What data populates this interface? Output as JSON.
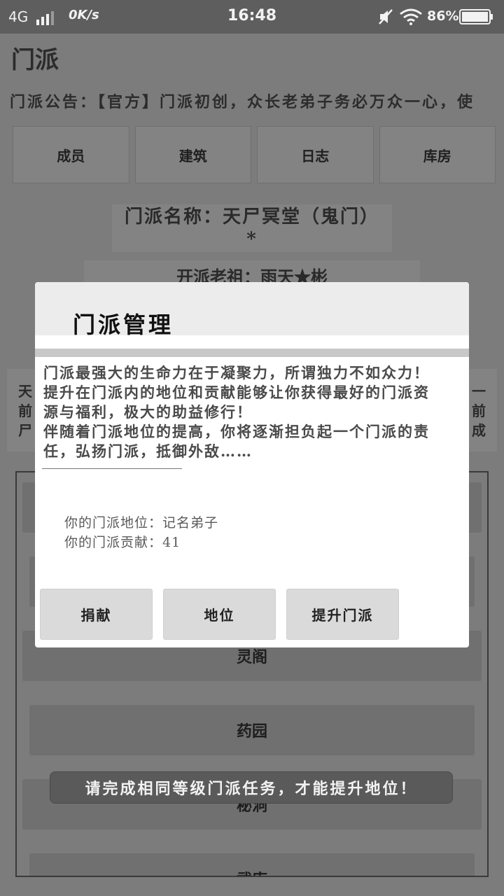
{
  "status_bar": {
    "network": "4G",
    "speed": "0K/s",
    "time": "16:48",
    "battery_percent": "86%",
    "icons": [
      "signal-icon",
      "mute-icon",
      "wifi-icon",
      "battery-icon"
    ]
  },
  "page": {
    "title": "门派",
    "notice": "门派公告：【官方】门派初创，众长老弟子务必万众一心，使",
    "tabs": [
      "成员",
      "建筑",
      "日志",
      "库房"
    ],
    "name_line1": "门派名称：天尸冥堂（鬼门）",
    "name_line2": "*",
    "founder": "开派老祖：雨天★彬",
    "info_left": [
      "天",
      "前",
      "尸"
    ],
    "info_right": [
      "一",
      "前",
      "成"
    ],
    "buildings": [
      "灵阁",
      "药园",
      "秘洞",
      "武库"
    ]
  },
  "dialog": {
    "title": "门派管理",
    "body_lines": [
      "门派最强大的生命力在于凝聚力，所谓独力不如众力！",
      "提升在门派内的地位和贡献能够让你获得最好的门派资",
      "源与福利，极大的助益修行！",
      "伴随着门派地位的提高，你将逐渐担负起一个门派的责",
      "任，弘扬门派，抵御外敌……"
    ],
    "position_label": "你的门派地位：",
    "position_value": "记名弟子",
    "contribution_label": "你的门派贡献：",
    "contribution_value": "41",
    "buttons": {
      "donate": "捐献",
      "position": "地位",
      "upgrade": "提升门派"
    }
  },
  "toast": "请完成相同等级门派任务，才能提升地位！"
}
